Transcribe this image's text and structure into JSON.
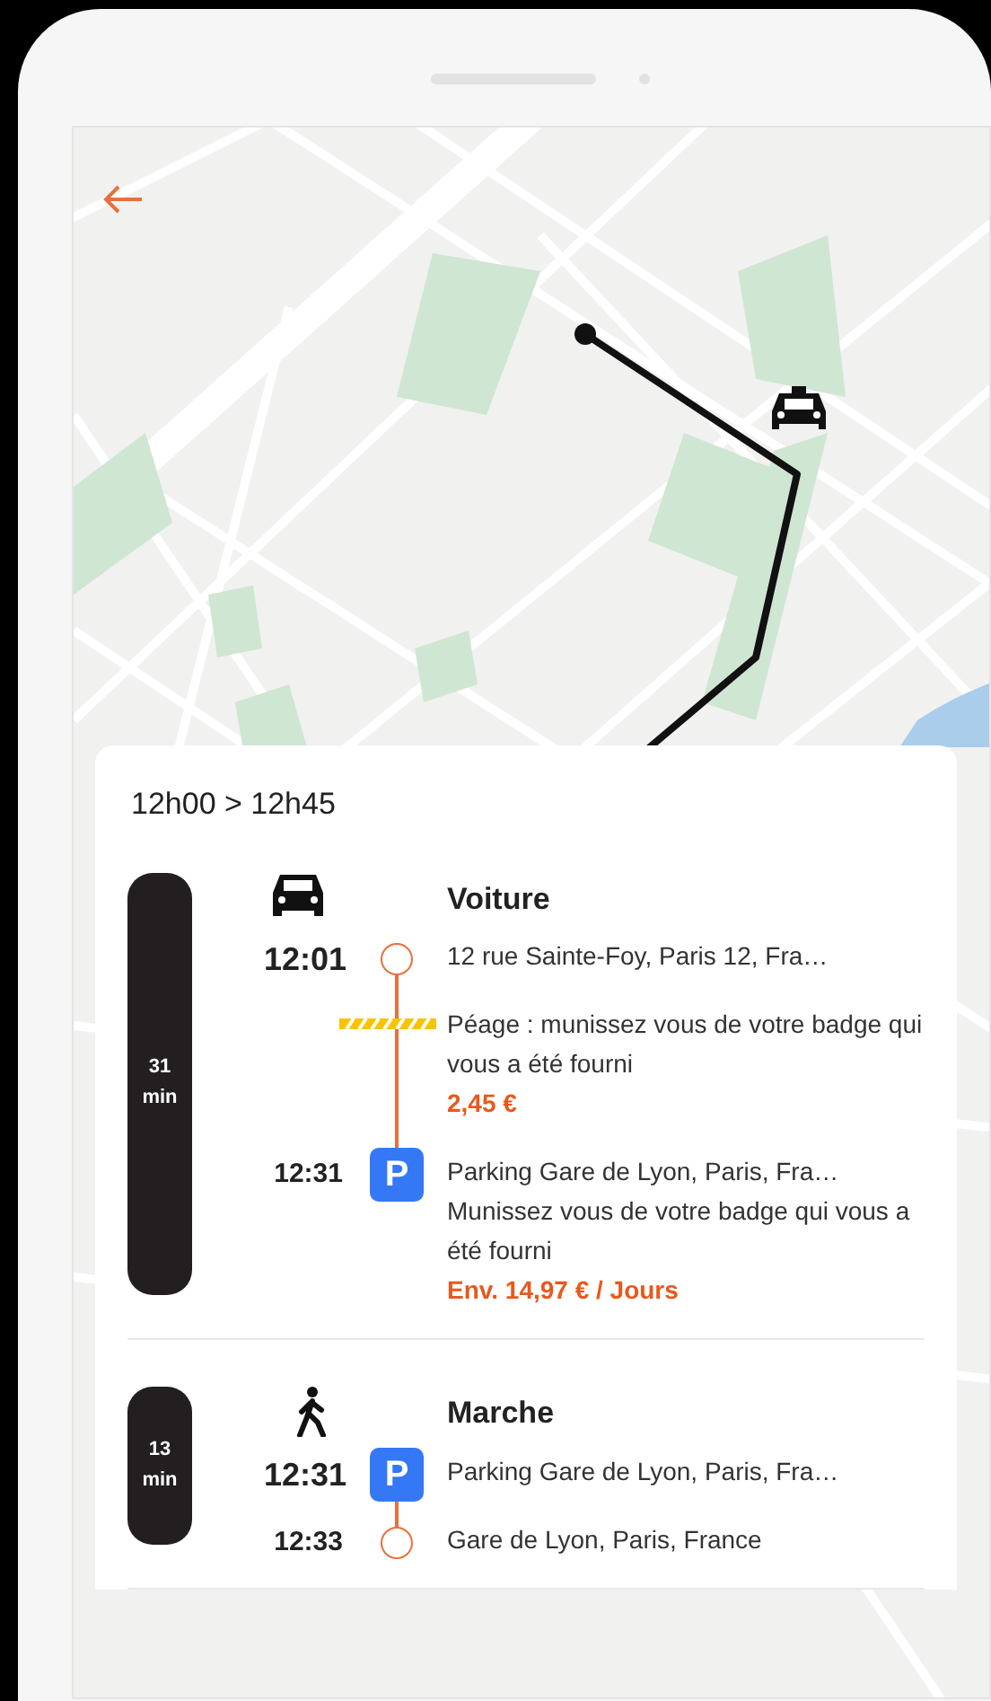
{
  "header": {
    "time_range": "12h00 > 12h45"
  },
  "segments": [
    {
      "duration": "31",
      "unit": "min",
      "kind": "car",
      "title": "Voiture",
      "rows": [
        {
          "kind": "stop",
          "marker": {
            "kind": "circle"
          },
          "time": "12:01",
          "lines": [
            "12 rue Sainte-Foy, Paris 12, Fra…"
          ]
        },
        {
          "kind": "toll",
          "lines": [
            "Péage : munissez vous de votre badge qui vous a été fourni"
          ],
          "price": "2,45 €"
        },
        {
          "kind": "stop",
          "marker": {
            "kind": "parking",
            "label": "P"
          },
          "time": "12:31",
          "lines": [
            "Parking Gare de Lyon, Paris, Fra…",
            "Munissez vous de votre badge qui vous a été fourni"
          ],
          "price": "Env. 14,97 € / Jours"
        }
      ]
    },
    {
      "duration": "13",
      "unit": "min",
      "kind": "walk",
      "title": "Marche",
      "rows": [
        {
          "kind": "stop",
          "marker": {
            "kind": "parking",
            "label": "P"
          },
          "time": "12:31",
          "lines": [
            "Parking Gare de Lyon, Paris, Fra…"
          ]
        },
        {
          "kind": "stop",
          "marker": {
            "kind": "circle"
          },
          "time": "12:33",
          "lines": [
            "Gare de Lyon, Paris, France"
          ]
        }
      ]
    }
  ]
}
